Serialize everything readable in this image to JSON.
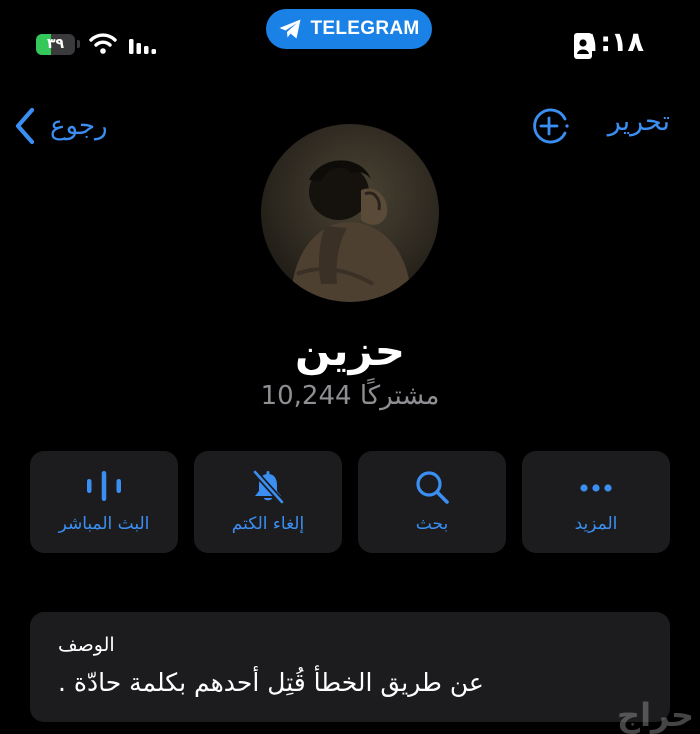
{
  "status_bar": {
    "battery_text": "٣٩",
    "battery_level": 0.39,
    "wifi_icon": "wifi-icon",
    "signal_icon": "cellular-signal-icon",
    "pill_label": "TELEGRAM",
    "pill_icon": "telegram-icon",
    "sim_icon": "sim-card-icon",
    "time": "١:١٨"
  },
  "nav": {
    "back_label": "رجوع",
    "back_icon": "chevron-left-icon",
    "add_icon": "add-circle-icon",
    "edit_label": "تحرير"
  },
  "profile": {
    "name": "حزين",
    "subscribers": "10,244 مشتركًا"
  },
  "actions": [
    {
      "label": "البث المباشر",
      "icon": "live-stream-icon"
    },
    {
      "label": "إلغاء الكتم",
      "icon": "muted-bell-icon"
    },
    {
      "label": "بحث",
      "icon": "search-icon"
    },
    {
      "label": "المزيد",
      "icon": "more-icon"
    }
  ],
  "description": {
    "label": "الوصف",
    "text": "عن طريق الخطأ قُتِل أحدهم بكلمة حادّة ."
  },
  "watermark": "حراج",
  "colors": {
    "accent": "#3b8ff2",
    "telegram_pill": "#1a82e6",
    "battery_green": "#34c759",
    "card_bg": "#1c1c1e",
    "secondary_text": "#8e8e93"
  }
}
